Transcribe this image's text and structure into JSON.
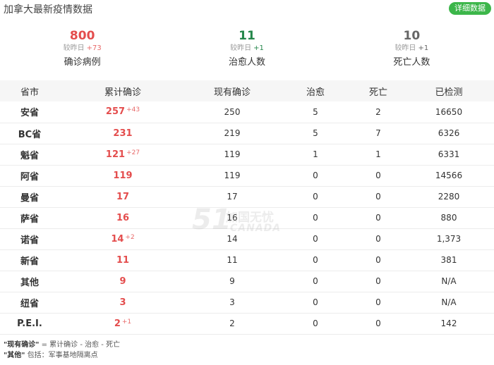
{
  "header": {
    "title": "加拿大最新疫情数据",
    "detail_button": "详细数据"
  },
  "summary": [
    {
      "value": "800",
      "delta_label": "较昨日",
      "delta": "+73",
      "label": "确诊病例",
      "color": "#e44d4d"
    },
    {
      "value": "11",
      "delta_label": "较昨日",
      "delta": "+1",
      "label": "治愈人数",
      "color": "#24864a"
    },
    {
      "value": "10",
      "delta_label": "较昨日",
      "delta": "+1",
      "label": "死亡人数",
      "color": "#666666"
    }
  ],
  "table": {
    "headers": [
      "省市",
      "累计确诊",
      "现有确诊",
      "治愈",
      "死亡",
      "已检测"
    ],
    "rows": [
      {
        "province": "安省",
        "cumulative": "257",
        "increase": "+43",
        "current": "250",
        "cured": "5",
        "dead": "2",
        "tested": "16650"
      },
      {
        "province": "BC省",
        "cumulative": "231",
        "increase": "",
        "current": "219",
        "cured": "5",
        "dead": "7",
        "tested": "6326"
      },
      {
        "province": "魁省",
        "cumulative": "121",
        "increase": "+27",
        "current": "119",
        "cured": "1",
        "dead": "1",
        "tested": "6331"
      },
      {
        "province": "阿省",
        "cumulative": "119",
        "increase": "",
        "current": "119",
        "cured": "0",
        "dead": "0",
        "tested": "14566"
      },
      {
        "province": "曼省",
        "cumulative": "17",
        "increase": "",
        "current": "17",
        "cured": "0",
        "dead": "0",
        "tested": "2280"
      },
      {
        "province": "萨省",
        "cumulative": "16",
        "increase": "",
        "current": "16",
        "cured": "0",
        "dead": "0",
        "tested": "880"
      },
      {
        "province": "诺省",
        "cumulative": "14",
        "increase": "+2",
        "current": "14",
        "cured": "0",
        "dead": "0",
        "tested": "1,373"
      },
      {
        "province": "新省",
        "cumulative": "11",
        "increase": "",
        "current": "11",
        "cured": "0",
        "dead": "0",
        "tested": "381"
      },
      {
        "province": "其他",
        "cumulative": "9",
        "increase": "",
        "current": "9",
        "cured": "0",
        "dead": "0",
        "tested": "N/A"
      },
      {
        "province": "纽省",
        "cumulative": "3",
        "increase": "",
        "current": "3",
        "cured": "0",
        "dead": "0",
        "tested": "N/A"
      },
      {
        "province": "P.E.I.",
        "cumulative": "2",
        "increase": "+1",
        "current": "2",
        "cured": "0",
        "dead": "0",
        "tested": "142"
      }
    ]
  },
  "watermark": {
    "number": "51",
    "cn": "加国无忧",
    "en": "CANADA"
  },
  "notes": [
    {
      "term": "\"现有确诊\"",
      "text": " = 累计确诊 - 治愈 - 死亡"
    },
    {
      "term": "\"其他\"",
      "text": " 包括：军事基地隔离点"
    }
  ],
  "colors": {
    "accent_green": "#3cb64a",
    "confirmed_red": "#e44d4d",
    "cured_green": "#24864a",
    "dead_gray": "#666666"
  }
}
